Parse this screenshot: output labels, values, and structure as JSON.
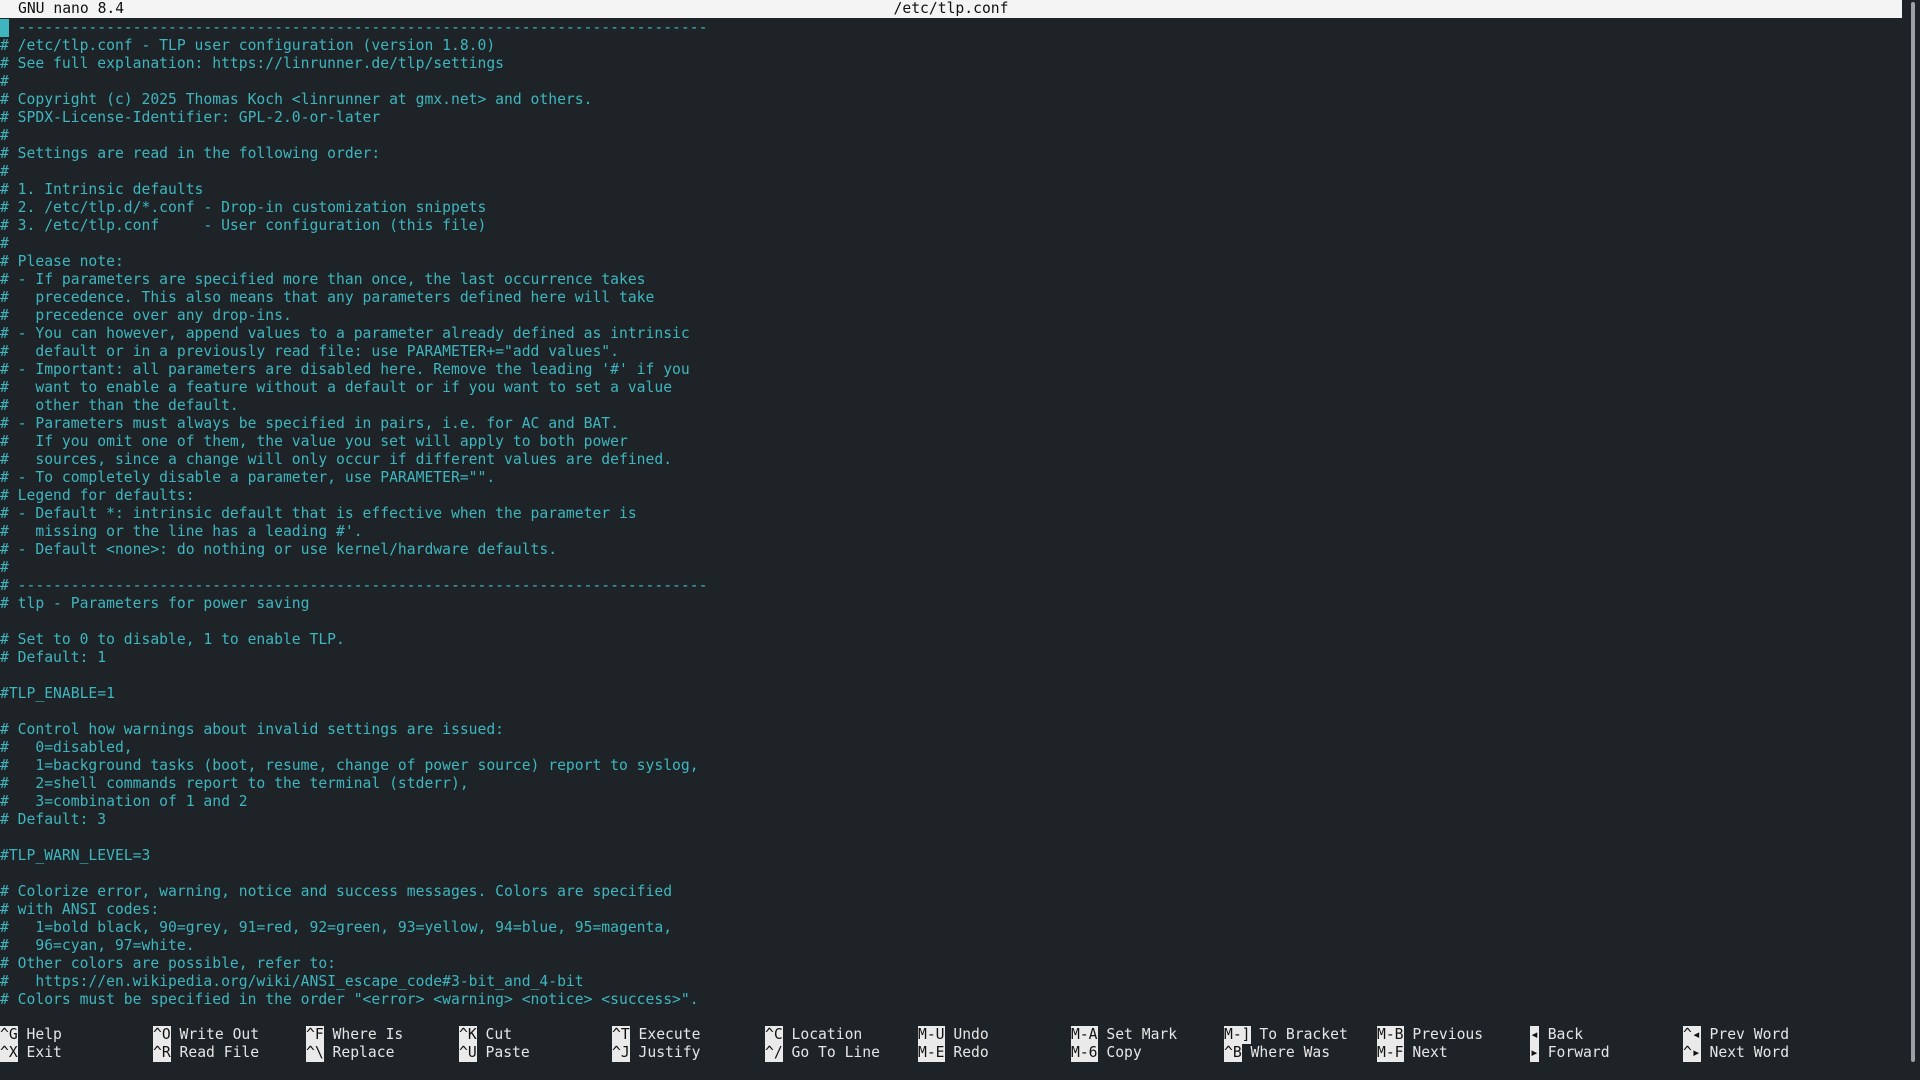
{
  "titlebar": {
    "app": "GNU nano 8.4",
    "filename": "/etc/tlp.conf"
  },
  "editor": {
    "lines": [
      "# ------------------------------------------------------------------------------",
      "# /etc/tlp.conf - TLP user configuration (version 1.8.0)",
      "# See full explanation: https://linrunner.de/tlp/settings",
      "#",
      "# Copyright (c) 2025 Thomas Koch <linrunner at gmx.net> and others.",
      "# SPDX-License-Identifier: GPL-2.0-or-later",
      "#",
      "# Settings are read in the following order:",
      "#",
      "# 1. Intrinsic defaults",
      "# 2. /etc/tlp.d/*.conf - Drop-in customization snippets",
      "# 3. /etc/tlp.conf     - User configuration (this file)",
      "#",
      "# Please note:",
      "# - If parameters are specified more than once, the last occurrence takes",
      "#   precedence. This also means that any parameters defined here will take",
      "#   precedence over any drop-ins.",
      "# - You can however, append values to a parameter already defined as intrinsic",
      "#   default or in a previously read file: use PARAMETER+=\"add values\".",
      "# - Important: all parameters are disabled here. Remove the leading '#' if you",
      "#   want to enable a feature without a default or if you want to set a value",
      "#   other than the default.",
      "# - Parameters must always be specified in pairs, i.e. for AC and BAT.",
      "#   If you omit one of them, the value you set will apply to both power",
      "#   sources, since a change will only occur if different values are defined.",
      "# - To completely disable a parameter, use PARAMETER=\"\".",
      "# Legend for defaults:",
      "# - Default *: intrinsic default that is effective when the parameter is",
      "#   missing or the line has a leading #'.",
      "# - Default <none>: do nothing or use kernel/hardware defaults.",
      "#",
      "# ------------------------------------------------------------------------------",
      "# tlp - Parameters for power saving",
      "",
      "# Set to 0 to disable, 1 to enable TLP.",
      "# Default: 1",
      "",
      "#TLP_ENABLE=1",
      "",
      "# Control how warnings about invalid settings are issued:",
      "#   0=disabled,",
      "#   1=background tasks (boot, resume, change of power source) report to syslog,",
      "#   2=shell commands report to the terminal (stderr),",
      "#   3=combination of 1 and 2",
      "# Default: 3",
      "",
      "#TLP_WARN_LEVEL=3",
      "",
      "# Colorize error, warning, notice and success messages. Colors are specified",
      "# with ANSI codes:",
      "#   1=bold black, 90=grey, 91=red, 92=green, 93=yellow, 94=blue, 95=magenta,",
      "#   96=cyan, 97=white.",
      "# Other colors are possible, refer to:",
      "#   https://en.wikipedia.org/wiki/ANSI_escape_code#3-bit_and_4-bit",
      "# Colors must be specified in the order \"<error> <warning> <notice> <success>\"."
    ]
  },
  "shortcuts": [
    {
      "key": "^G",
      "label": "Help"
    },
    {
      "key": "^X",
      "label": "Exit"
    },
    {
      "key": "^O",
      "label": "Write Out"
    },
    {
      "key": "^R",
      "label": "Read File"
    },
    {
      "key": "^F",
      "label": "Where Is"
    },
    {
      "key": "^\\",
      "label": "Replace"
    },
    {
      "key": "^K",
      "label": "Cut"
    },
    {
      "key": "^U",
      "label": "Paste"
    },
    {
      "key": "^T",
      "label": "Execute"
    },
    {
      "key": "^J",
      "label": "Justify"
    },
    {
      "key": "^C",
      "label": "Location"
    },
    {
      "key": "^/",
      "label": "Go To Line"
    },
    {
      "key": "M-U",
      "label": "Undo"
    },
    {
      "key": "M-E",
      "label": "Redo"
    },
    {
      "key": "M-A",
      "label": "Set Mark"
    },
    {
      "key": "M-6",
      "label": "Copy"
    },
    {
      "key": "M-]",
      "label": "To Bracket"
    },
    {
      "key": "^B",
      "label": "Where Was"
    },
    {
      "key": "M-B",
      "label": "Previous"
    },
    {
      "key": "M-F",
      "label": "Next"
    },
    {
      "key": "◂",
      "label": "Back"
    },
    {
      "key": "▸",
      "label": "Forward"
    },
    {
      "key": "^◂",
      "label": "Prev Word"
    },
    {
      "key": "^▸",
      "label": "Next Word"
    }
  ],
  "colors": {
    "background": "#1d2327",
    "comment": "#3fb6bf",
    "titlebar_bg": "#f4f4f4",
    "shortcut_key_bg": "#eaeaea"
  }
}
